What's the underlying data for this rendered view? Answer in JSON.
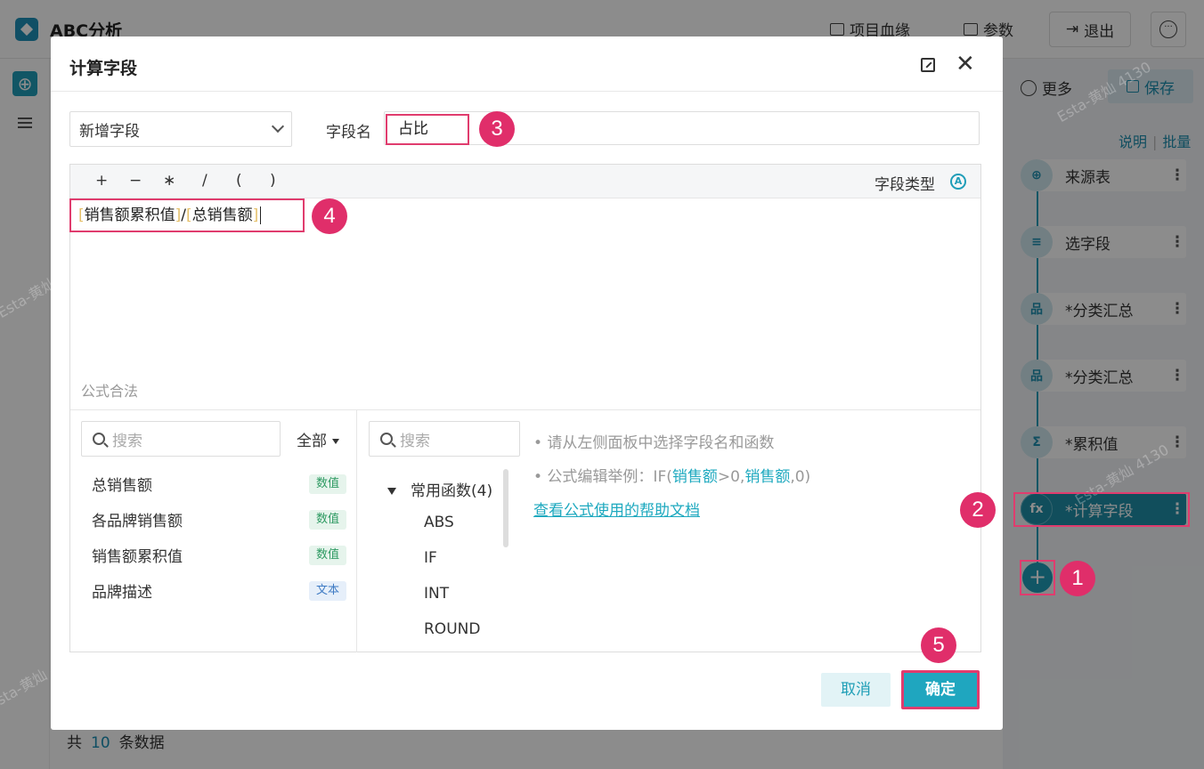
{
  "app": {
    "title": "ABC分析",
    "lineage_label": "项目血缘",
    "params_label": "参数",
    "exit_label": "退出"
  },
  "right_panel": {
    "more_label": "更多",
    "save_label": "保存",
    "explain_label": "说明",
    "batch_label": "批量",
    "steps": [
      {
        "label": "来源表",
        "icon": "source-icon"
      },
      {
        "label": "选字段",
        "icon": "select-fields-icon"
      },
      {
        "label": "*分类汇总",
        "icon": "group-summary-icon"
      },
      {
        "label": "*分类汇总",
        "icon": "group-summary-icon"
      },
      {
        "label": "*累积值",
        "icon": "cumulative-icon"
      },
      {
        "label": "*计算字段",
        "icon": "formula-icon"
      }
    ],
    "add_step": "+"
  },
  "footer": {
    "prefix": "共",
    "count": "10",
    "suffix": "条数据"
  },
  "dialog": {
    "title": "计算字段",
    "mode_select": "新增字段",
    "field_name_label": "字段名",
    "field_name_value": "占比",
    "operators": [
      "+",
      "−",
      "∗",
      "/",
      "(",
      ")"
    ],
    "field_type_label": "字段类型",
    "formula": {
      "field1": "销售额累积值",
      "operator": "/",
      "field2": "总销售额"
    },
    "validation": "公式合法",
    "field_search_placeholder": "搜索",
    "field_filter": "全部",
    "fields": [
      {
        "name": "总销售额",
        "type": "数值"
      },
      {
        "name": "各品牌销售额",
        "type": "数值"
      },
      {
        "name": "销售额累积值",
        "type": "数值"
      },
      {
        "name": "品牌描述",
        "type": "文本"
      }
    ],
    "fn_search_placeholder": "搜索",
    "fn_group": "常用函数(4)",
    "functions": [
      "ABS",
      "IF",
      "INT",
      "ROUND"
    ],
    "hint1": "• 请从左侧面板中选择字段名和函数",
    "hint2_prefix": "• 公式编辑举例：IF(",
    "hint2_field": "销售额",
    "hint2_mid": ">0,",
    "hint2_field2": "销售额",
    "hint2_suffix": ",0)",
    "help_link": "查看公式使用的帮助文档",
    "cancel_label": "取消",
    "ok_label": "确定"
  },
  "markers": [
    "1",
    "2",
    "3",
    "4",
    "5"
  ],
  "watermark": "Esta-黄灿 4130",
  "colors": {
    "accent": "#1fa6bf",
    "highlight": "#e03c6e",
    "marker": "#e02e6a"
  }
}
